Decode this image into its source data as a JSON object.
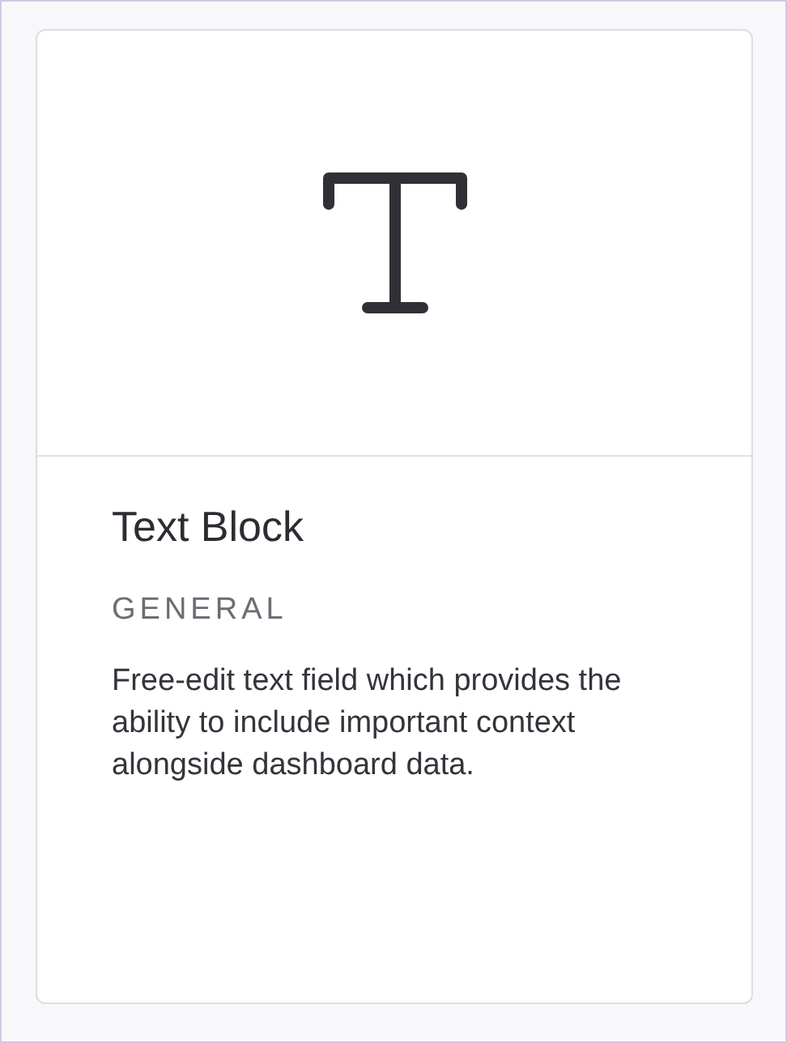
{
  "card": {
    "title": "Text Block",
    "category": "GENERAL",
    "description": "Free-edit text field which provides the ability to include important context alongside dashboard data."
  }
}
